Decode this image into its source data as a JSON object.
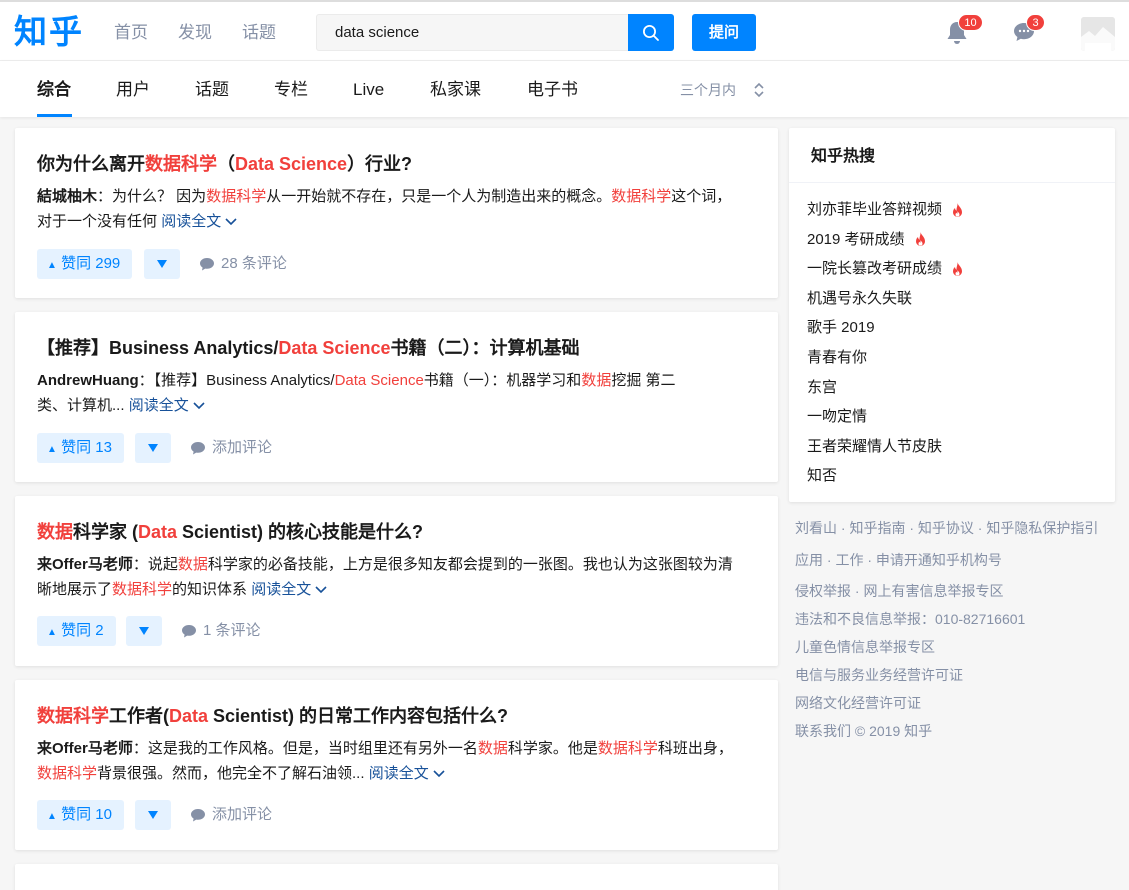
{
  "header": {
    "logo": "知乎",
    "nav": [
      "首页",
      "发现",
      "话题"
    ],
    "search_value": "data science",
    "ask_label": "提问",
    "notifications_count": "10",
    "messages_count": "3"
  },
  "tabs": {
    "items": [
      "综合",
      "用户",
      "话题",
      "专栏",
      "Live",
      "私家课",
      "电子书"
    ],
    "active": "综合",
    "period": "三个月内"
  },
  "results": [
    {
      "title_parts": [
        "你为什么离开",
        "数据科学",
        "（",
        "Data Science",
        "）行业?"
      ],
      "author": "結城柚木",
      "excerpt_l1": [
        "：为什么？ 因为",
        "数据科学",
        "从一开始就不存在，只是一个人为制造出来的概念。",
        "数据科学",
        "这个词，"
      ],
      "excerpt_l2": "对于一个没有任何",
      "read_more": "阅读全文",
      "vote": "赞同 299",
      "comment": "28 条评论"
    },
    {
      "title_parts": [
        "【推荐】Business Analytics/",
        "Data Science",
        "书籍（二）：计算机基础"
      ],
      "author": "AndrewHuang",
      "excerpt_l1": [
        "：【推荐】Business Analytics/",
        "Data Science",
        "书籍（一）：机器学习和",
        "数据",
        "挖掘 第二"
      ],
      "excerpt_l2": "类、计算机...",
      "read_more": "阅读全文",
      "vote": "赞同 13",
      "comment": "添加评论"
    },
    {
      "title_parts": [
        "数据",
        "科学家 (",
        "Data",
        " Scientist) 的核心技能是什么?"
      ],
      "author": "来Offer马老师",
      "excerpt_l1": [
        "：说起",
        "数据",
        "科学家的必备技能，上方是很多知友都会提到的一张图。我也认为这张图较为清"
      ],
      "excerpt_l2_parts": [
        "晰地展示了",
        "数据科学",
        "的知识体系"
      ],
      "read_more": "阅读全文",
      "vote": "赞同 2",
      "comment": "1 条评论"
    },
    {
      "title_parts": [
        "数据科学",
        "工作者(",
        "Data",
        " Scientist) 的日常工作内容包括什么?"
      ],
      "author": "来Offer马老师",
      "excerpt_l1": [
        "：这是我的工作风格。但是，当时组里还有另外一名",
        "数据",
        "科学家。他是",
        "数据科学",
        "科班出身，"
      ],
      "excerpt_l2_parts": [
        "数据科学",
        "背景很强。然而，他完全不了解石油领..."
      ],
      "read_more": "阅读全文",
      "vote": "赞同 10",
      "comment": "添加评论"
    }
  ],
  "sidebar": {
    "title": "知乎热搜",
    "items": [
      {
        "label": "刘亦菲毕业答辩视频",
        "hot": true
      },
      {
        "label": "2019 考研成绩",
        "hot": true
      },
      {
        "label": "一院长篡改考研成绩",
        "hot": true
      },
      {
        "label": "机遇号永久失联",
        "hot": false
      },
      {
        "label": "歌手 2019",
        "hot": false
      },
      {
        "label": "青春有你",
        "hot": false
      },
      {
        "label": "东宫",
        "hot": false
      },
      {
        "label": "一吻定情",
        "hot": false
      },
      {
        "label": "王者荣耀情人节皮肤",
        "hot": false
      },
      {
        "label": "知否",
        "hot": false
      }
    ]
  },
  "footer": {
    "lines": [
      "刘看山 · 知乎指南 · 知乎协议 · 知乎隐私保护指引",
      "应用 · 工作 · 申请开通知乎机构号",
      "侵权举报 · 网上有害信息举报专区",
      "违法和不良信息举报：010-82716601",
      "儿童色情信息举报专区",
      "电信与服务业务经营许可证",
      "网络文化经营许可证",
      "联系我们 © 2019 知乎"
    ]
  },
  "colors": {
    "brand": "#0084ff",
    "highlight": "#f1403c",
    "muted": "#8590a6",
    "link": "#175199"
  }
}
